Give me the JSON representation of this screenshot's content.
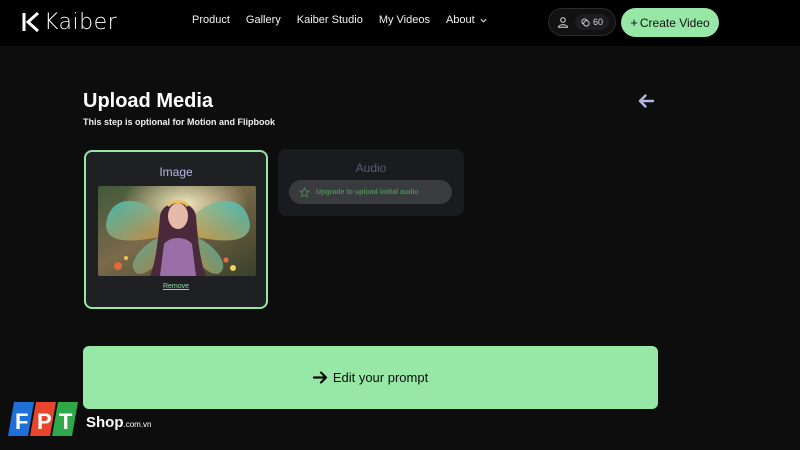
{
  "nav": {
    "logo_text": "Kaiber",
    "links": [
      "Product",
      "Gallery",
      "Kaiber Studio",
      "My Videos"
    ],
    "about_label": "About",
    "credits": "60",
    "create_label": "Create Video"
  },
  "header": {
    "title": "Upload Media",
    "subtitle": "This step is optional for Motion and Flipbook"
  },
  "image_card": {
    "label": "Image",
    "remove_label": "Remove",
    "selected": true
  },
  "audio_card": {
    "label": "Audio",
    "upgrade_label": "Upgrade to upload initial audio",
    "disabled": true
  },
  "prompt_button": {
    "label": "Edit your prompt"
  },
  "watermark": {
    "logo_letters": "FPT",
    "shop": "Shop",
    "domain": ".com.vn"
  },
  "colors": {
    "accent_green": "#97e7a6",
    "card_label_purple": "#b9b6e6",
    "background": "#0d0d0e"
  }
}
